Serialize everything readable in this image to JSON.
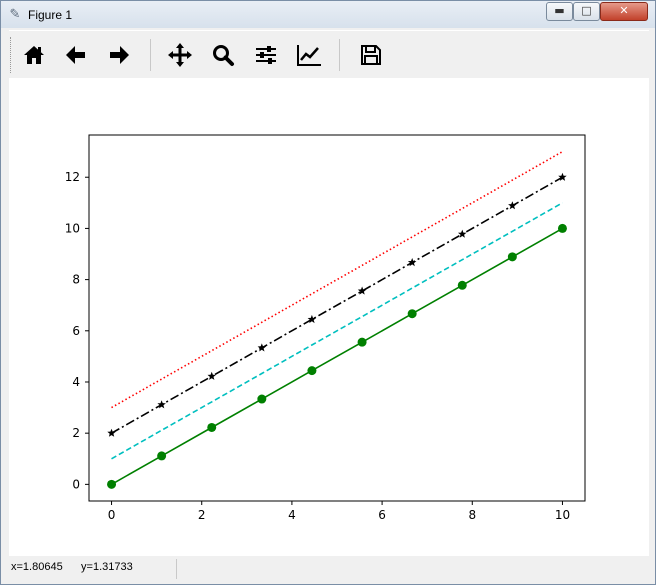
{
  "window": {
    "title": "Figure 1",
    "min_label": "▬",
    "max_label": "□",
    "close_label": "✕"
  },
  "toolbar": {
    "buttons": [
      {
        "name": "home-button",
        "icon": "home-icon"
      },
      {
        "name": "back-button",
        "icon": "arrow-left-icon"
      },
      {
        "name": "forward-button",
        "icon": "arrow-right-icon"
      },
      {
        "name": "pan-button",
        "icon": "move-icon"
      },
      {
        "name": "zoom-button",
        "icon": "search-icon"
      },
      {
        "name": "subplots-button",
        "icon": "sliders-icon"
      },
      {
        "name": "edit-axes-button",
        "icon": "line-chart-icon"
      },
      {
        "name": "save-button",
        "icon": "save-icon"
      }
    ]
  },
  "status": {
    "coords": "x=1.80645      y=1.31733"
  },
  "colors": {
    "green": "#008000",
    "cyan": "#00bfbf",
    "black": "#000000",
    "red": "#ff0000"
  },
  "chart_data": {
    "type": "line",
    "xlim": [
      -0.5,
      10.5
    ],
    "ylim": [
      -0.65,
      13.65
    ],
    "xticks": [
      0,
      2,
      4,
      6,
      8,
      10
    ],
    "yticks": [
      0,
      2,
      4,
      6,
      8,
      10,
      12
    ],
    "series": [
      {
        "x": [
          0,
          1.111,
          2.222,
          3.333,
          4.444,
          5.556,
          6.667,
          7.778,
          8.889,
          10
        ],
        "y": [
          0,
          1.111,
          2.222,
          3.333,
          4.444,
          5.556,
          6.667,
          7.778,
          8.889,
          10
        ],
        "color": "#008000",
        "linestyle": "solid",
        "marker": "o"
      },
      {
        "x": [
          0,
          1.111,
          2.222,
          3.333,
          4.444,
          5.556,
          6.667,
          7.778,
          8.889,
          10
        ],
        "y": [
          1,
          2.111,
          3.222,
          4.333,
          5.444,
          6.556,
          7.667,
          8.778,
          9.889,
          11
        ],
        "color": "#00bfbf",
        "linestyle": "dashed",
        "marker": ""
      },
      {
        "x": [
          0,
          1.111,
          2.222,
          3.333,
          4.444,
          5.556,
          6.667,
          7.778,
          8.889,
          10
        ],
        "y": [
          2,
          3.111,
          4.222,
          5.333,
          6.444,
          7.556,
          8.667,
          9.778,
          10.889,
          12
        ],
        "color": "#000000",
        "linestyle": "dashdot",
        "marker": "*"
      },
      {
        "x": [
          0,
          1.111,
          2.222,
          3.333,
          4.444,
          5.556,
          6.667,
          7.778,
          8.889,
          10
        ],
        "y": [
          3,
          4.111,
          5.222,
          6.333,
          7.444,
          8.556,
          9.667,
          10.778,
          11.889,
          13
        ],
        "color": "#ff0000",
        "linestyle": "dotted",
        "marker": ""
      }
    ]
  }
}
